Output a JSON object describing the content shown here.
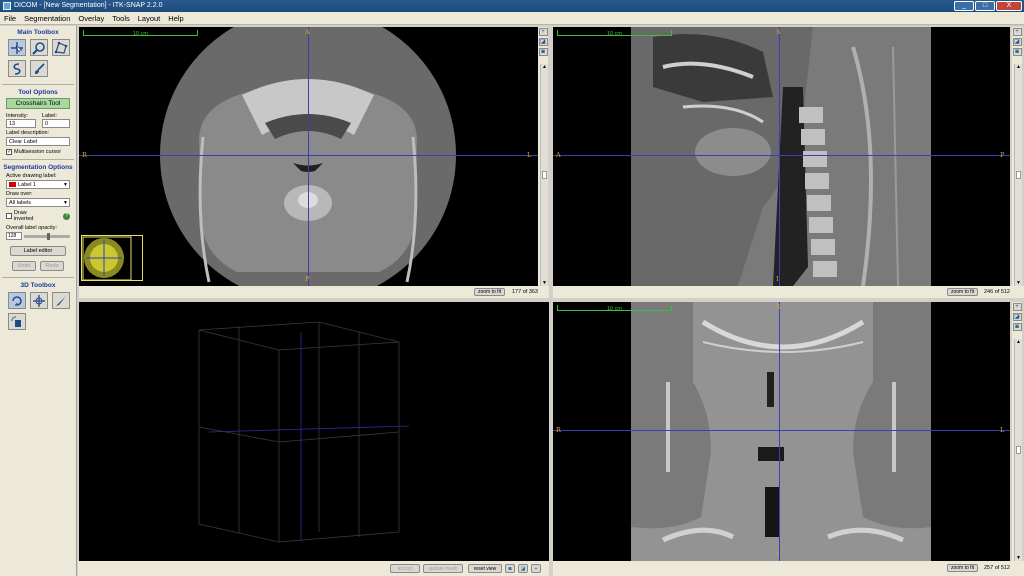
{
  "window": {
    "title": "DICOM - [New Segmentation] - ITK-SNAP 2.2.0",
    "buttons": [
      "_",
      "□",
      "X"
    ]
  },
  "menu": [
    "File",
    "Segmentation",
    "Overlay",
    "Tools",
    "Layout",
    "Help"
  ],
  "left_panel": {
    "main_toolbox_title": "Main Toolbox",
    "main_tools": [
      "crosshairs-tool",
      "zoom-tool",
      "polygon-tool",
      "snake-tool",
      "paintbrush-tool"
    ],
    "tool_options_title": "Tool Options",
    "active_tool": "Crosshairs Tool",
    "intensity_label": "Intensity:",
    "intensity_value": "13",
    "label_label": "Label:",
    "label_value": "0",
    "label_description_label": "Label description:",
    "label_description_value": "Clear Label",
    "multisession_cursor": "Multisession cursor",
    "segmentation_options_title": "Segmentation Options",
    "active_drawing_label_label": "Active drawing label:",
    "active_drawing_label_value": "Label 1",
    "draw_over_label": "Draw over:",
    "draw_over_value": "All labels",
    "draw_inverted": "Draw inverted",
    "help_glyph": "?",
    "overall_opacity_label": "Overall label opacity:",
    "overall_opacity_value": "128",
    "overall_opacity_fraction": 0.5,
    "label_editor_button": "Label editor",
    "undo_button": "Undo",
    "redo_button": "Redo",
    "toolbox_3d_title": "3D Toolbox",
    "tools_3d": [
      "rotate-3d-tool",
      "crosshair-3d-tool",
      "scalpel-tool",
      "spray-tool"
    ]
  },
  "views": {
    "axial": {
      "zoom_button": "zoom to fit",
      "slice": "177 of 363",
      "ruler": "10 cm",
      "orient": {
        "top": "A",
        "bottom": "P",
        "left": "R",
        "right": "L"
      },
      "scroll_fraction": 0.5
    },
    "sagittal": {
      "zoom_button": "zoom to fit",
      "slice": "246 of 512",
      "ruler": "10 cm",
      "orient": {
        "top": "S",
        "bottom": "I",
        "left": "A",
        "right": "P"
      },
      "scroll_fraction": 0.5
    },
    "coronal": {
      "zoom_button": "zoom to fit",
      "slice": "257 of 512",
      "ruler": "10 cm",
      "orient": {
        "top": "S",
        "bottom": "I",
        "left": "R",
        "right": "L"
      },
      "scroll_fraction": 0.5
    }
  },
  "view3d": {
    "accept": "accept",
    "update_mesh": "update mesh",
    "reset_view": "reset view"
  },
  "colors": {
    "crosshair": "#3840b8",
    "orientation_label": "#e8a020",
    "ruler": "#3ac03a",
    "tool_active": "#a8d8a0",
    "section_title": "#1a3a9a"
  }
}
